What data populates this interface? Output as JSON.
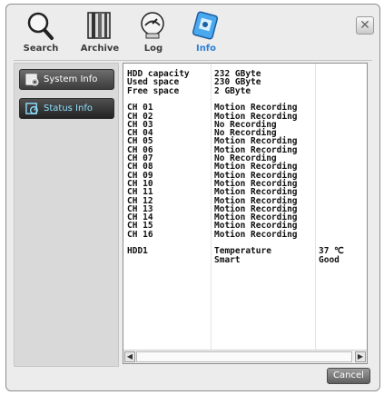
{
  "toolbar": {
    "items": [
      {
        "label": "Search",
        "icon": "search-icon"
      },
      {
        "label": "Archive",
        "icon": "archive-icon"
      },
      {
        "label": "Log",
        "icon": "log-icon"
      },
      {
        "label": "Info",
        "icon": "info-icon",
        "active": true
      }
    ],
    "close": "✕"
  },
  "sidebar": {
    "items": [
      {
        "label": "System Info",
        "icon": "system-info-icon"
      },
      {
        "label": "Status Info",
        "icon": "status-info-icon",
        "active": true
      }
    ]
  },
  "info_table": {
    "rows": [
      [
        "HDD capacity",
        "232 GByte",
        ""
      ],
      [
        "Used space",
        "230 GByte",
        ""
      ],
      [
        "Free space",
        "2 GByte",
        ""
      ],
      [
        "",
        "",
        ""
      ],
      [
        "CH 01",
        "Motion Recording",
        ""
      ],
      [
        "CH 02",
        "Motion Recording",
        ""
      ],
      [
        "CH 03",
        "No Recording",
        ""
      ],
      [
        "CH 04",
        "No Recording",
        ""
      ],
      [
        "CH 05",
        "Motion Recording",
        ""
      ],
      [
        "CH 06",
        "Motion Recording",
        ""
      ],
      [
        "CH 07",
        "No Recording",
        ""
      ],
      [
        "CH 08",
        "Motion Recording",
        ""
      ],
      [
        "CH 09",
        "Motion Recording",
        ""
      ],
      [
        "CH 10",
        "Motion Recording",
        ""
      ],
      [
        "CH 11",
        "Motion Recording",
        ""
      ],
      [
        "CH 12",
        "Motion Recording",
        ""
      ],
      [
        "CH 13",
        "Motion Recording",
        ""
      ],
      [
        "CH 14",
        "Motion Recording",
        ""
      ],
      [
        "CH 15",
        "Motion Recording",
        ""
      ],
      [
        "CH 16",
        "Motion Recording",
        ""
      ],
      [
        "",
        "",
        ""
      ],
      [
        "HDD1",
        "Temperature",
        "37 ℃"
      ],
      [
        "",
        "Smart",
        "Good"
      ]
    ]
  },
  "buttons": {
    "cancel": "Cancel"
  },
  "colors": {
    "accent": "#2f7fd6",
    "active_nav_text": "#8fe0ff",
    "panel_border": "#8d8d8d"
  }
}
